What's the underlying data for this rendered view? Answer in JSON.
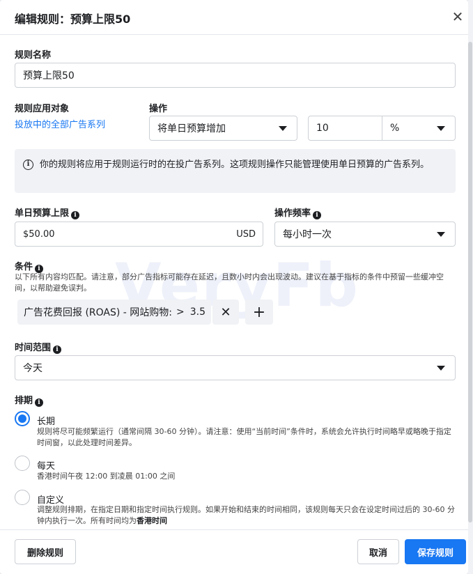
{
  "dialog": {
    "title": "编辑规则：预算上限50",
    "close_icon": "✕"
  },
  "rule_name": {
    "label": "规则名称",
    "value": "预算上限50"
  },
  "apply_to": {
    "label": "规则应用对象",
    "link": "投放中的全部广告系列"
  },
  "action": {
    "label": "操作",
    "select": "将单日预算增加",
    "amount": "10",
    "unit": "%"
  },
  "notice": {
    "text": "你的规则将应用于规则运行时的在投广告系列。这项规则操作只能管理使用单日预算的广告系列。"
  },
  "budget_cap": {
    "label": "单日预算上限",
    "value": "$50.00",
    "currency": "USD"
  },
  "frequency": {
    "label": "操作频率",
    "value": "每小时一次"
  },
  "conditions": {
    "label": "条件",
    "desc": "以下所有内容均匹配。请注意，部分广告指标可能存在延迟，且数小时内会出现波动。建议在基于指标的条件中预留一些缓冲空间，以帮助避免误判。",
    "item": {
      "metric": "广告花费回报 (ROAS) - 网站购物:",
      "op": ">",
      "value": "3.5"
    },
    "remove_icon": "✕",
    "add_icon": "+"
  },
  "time_range": {
    "label": "时间范围",
    "value": "今天"
  },
  "schedule": {
    "label": "排期",
    "options": [
      {
        "title": "长期",
        "desc": "规则将尽可能频繁运行（通常间隔 30-60 分钟）。请注意：使用“当前时间”条件时，系统会允许执行时间略早或略晚于指定时间窗，以此处理时间差异。"
      },
      {
        "title": "每天",
        "desc": "香港时间午夜 12:00 到凌晨 01:00 之间"
      },
      {
        "title": "自定义",
        "desc": "调整规则排期，在指定日期和指定时间执行规则。如果开始和结束的时间相同，该规则每天只会在设定时间过后的 30-60 分钟内执行一次。所有时间均为",
        "desc_bold": "香港时间"
      }
    ],
    "selected": 0
  },
  "footer": {
    "delete": "删除规则",
    "cancel": "取消",
    "save": "保存规则"
  },
  "watermark": "VeryFb",
  "colors": {
    "accent": "#1877f2",
    "border": "#ccd0d5",
    "notice_bg": "#f0f2f5"
  }
}
